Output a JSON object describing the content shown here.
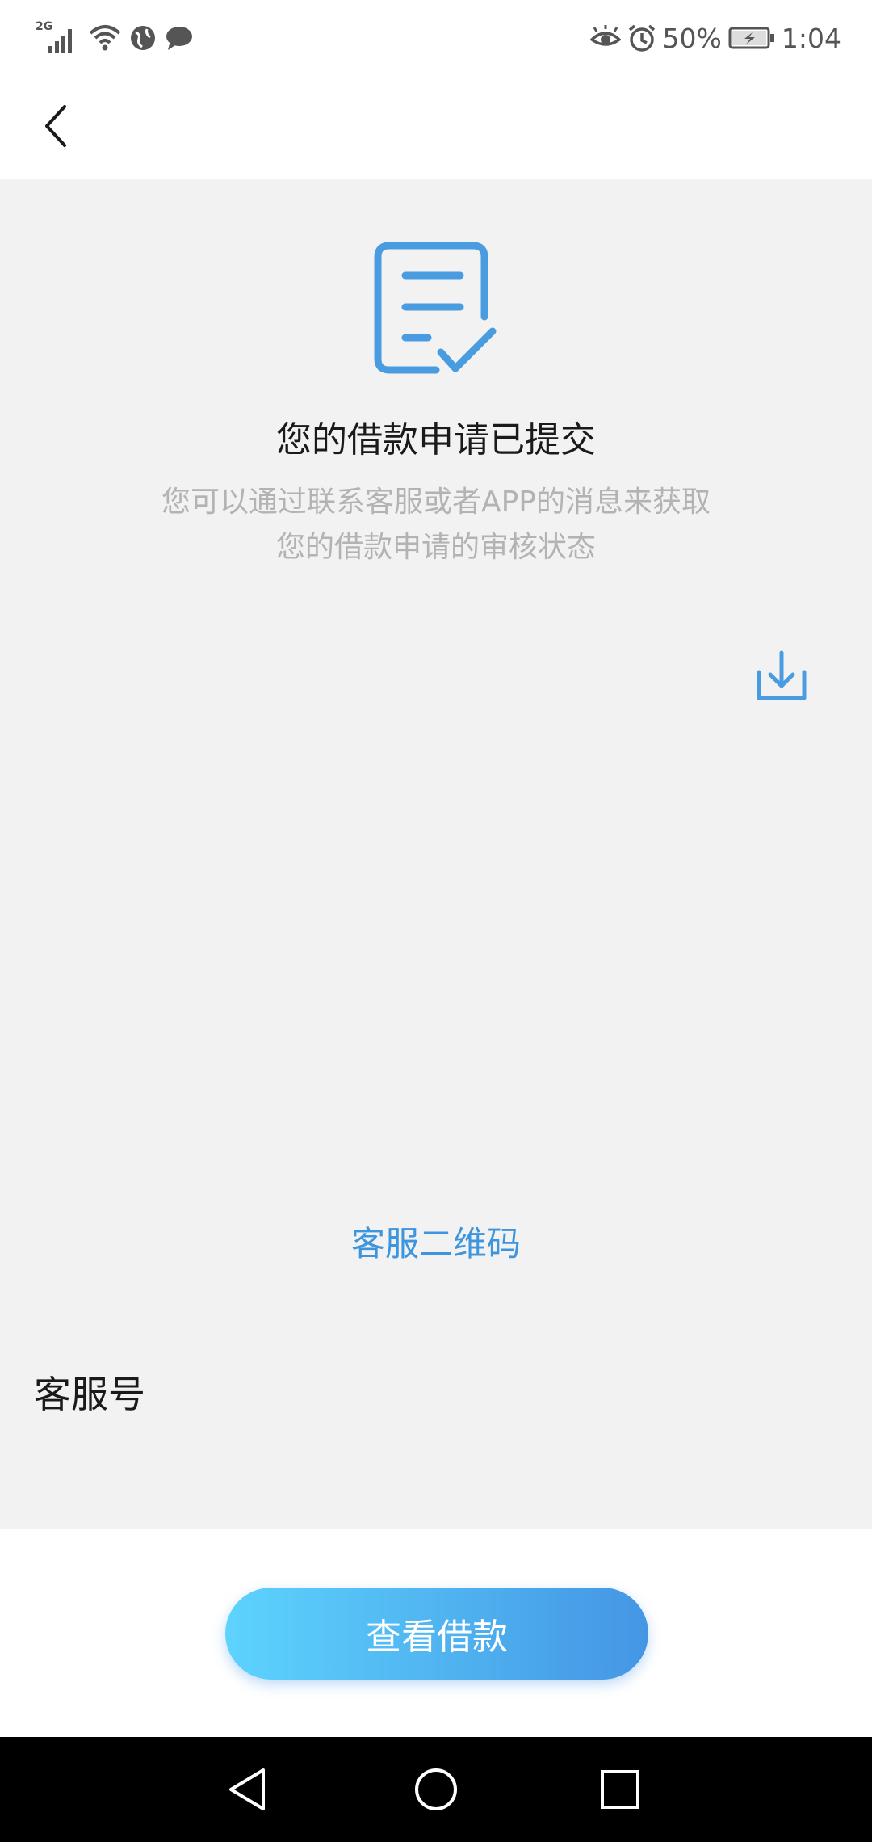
{
  "status_bar": {
    "network_type": "2G",
    "battery_percent": "50%",
    "time": "1:04",
    "left_icons": [
      "signal-icon",
      "wifi-icon",
      "globe-icon",
      "message-icon"
    ],
    "right_icons": [
      "eye-icon",
      "alarm-icon",
      "battery-charging-icon"
    ]
  },
  "header": {
    "back_icon": "back-chevron-icon"
  },
  "submission": {
    "icon": "document-check-icon",
    "title": "您的借款申请已提交",
    "description_line1": "您可以通过联系客服或者APP的消息来获取",
    "description_line2": "您的借款申请的审核状态"
  },
  "qr_section": {
    "download_icon": "download-icon",
    "label": "客服二维码"
  },
  "service": {
    "label": "客服号"
  },
  "actions": {
    "view_loan_label": "查看借款"
  },
  "system_nav": {
    "back_icon": "nav-back-icon",
    "home_icon": "nav-home-icon",
    "recents_icon": "nav-recents-icon"
  },
  "colors": {
    "accent": "#3d95dd",
    "button_gradient_start": "#5dd3fd",
    "button_gradient_end": "#4496e4",
    "content_background": "#f2f2f2"
  }
}
